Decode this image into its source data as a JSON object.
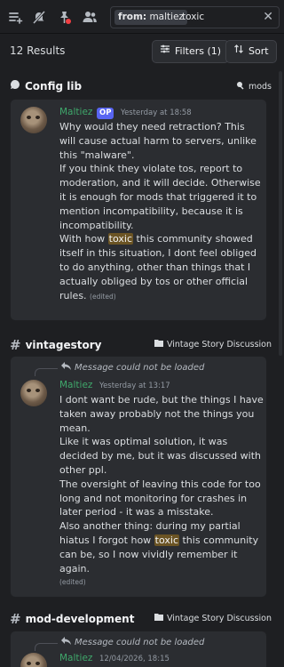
{
  "toolbar": {
    "icons": [
      "threads-icon",
      "mute-bell-icon",
      "pin-icon",
      "members-icon"
    ],
    "search_chip_key": "from:",
    "search_chip_value": "maltiez",
    "search_term": "toxic"
  },
  "results": {
    "count_label": "12 Results",
    "filters_label": "Filters (1)",
    "sort_label": "Sort"
  },
  "groups": [
    {
      "channel": "Config lib",
      "forum_tag": "mods",
      "message": {
        "author": "Maltiez",
        "badge": "OP",
        "timestamp": "Yesterday at 18:58",
        "text_before": "Why would they need retraction? This will cause actual harm to servers, unlike this \"malware\".\nIf you think they violate tos, report to moderation, and it will decide. Otherwise it is enough for mods that triggered it to mention incompatibility, because it is incompatibility.\nWith how ",
        "highlight": "toxic",
        "text_after": " this community showed itself in this situation, I dont feel obliged to do anything, other than things that I actually obliged by tos or other official rules.",
        "edited": "(edited)"
      }
    },
    {
      "channel": "vintagestory",
      "server": "Vintage Story Discussion",
      "message": {
        "reply": "Message could not be loaded",
        "author": "Maltiez",
        "timestamp": "Yesterday at 13:17",
        "text_before": "I dont want be rude, but the things I have taken away probably not the things you mean.\nLike it was optimal solution, it was decided by me, but it was discussed with other ppl.\nThe oversight of leaving this code for too long and not monitoring for crashes in later period - it was a misstake.\nAlso another thing: during my partial hiatus I forgot how ",
        "highlight": "toxic",
        "text_after": " this community can be, so I now vividly remember it again.",
        "edited": "(edited)"
      }
    },
    {
      "channel": "mod-development",
      "server": "Vintage Story Discussion",
      "message": {
        "reply": "Message could not be loaded",
        "author": "Maltiez",
        "timestamp": "12/04/2026, 18:15"
      }
    }
  ],
  "colors": {
    "background": "#1e1f22",
    "card": "#2b2d31",
    "author": "#3fa86b",
    "op_badge": "#5865f2",
    "highlight": "#6b5424"
  }
}
